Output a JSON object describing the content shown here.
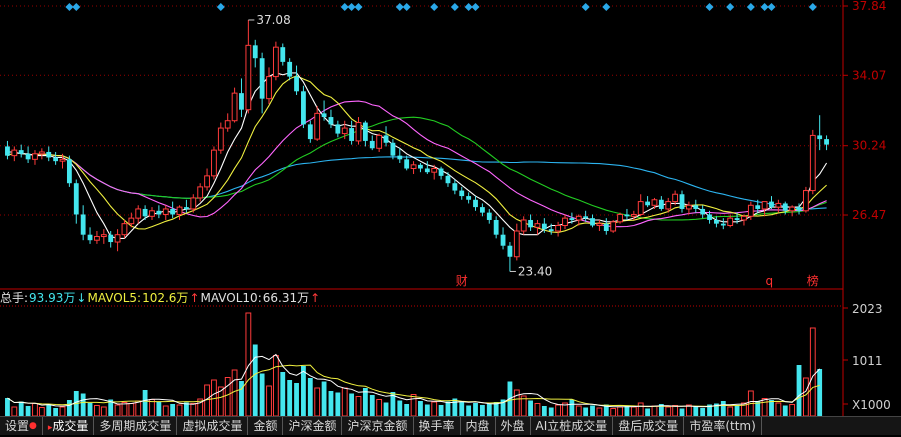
{
  "colors": {
    "up": "#ff3b3b",
    "down": "#44e6ee",
    "ma5": "#ffffff",
    "ma10": "#f0f040",
    "ma20": "#ff66ff",
    "ma30": "#22cc22",
    "ma60": "#2cb4f0",
    "axis": "#c00000",
    "diamond": "#2aa8e8"
  },
  "price_axis": {
    "labels": [
      "37.84",
      "34.07",
      "30.24",
      "26.47"
    ]
  },
  "volume_axis": {
    "labels": [
      "2023",
      "1011",
      "X1000"
    ]
  },
  "volume_header": {
    "total_label": "总手:",
    "total_value": "93.93万",
    "total_arrow": "↓",
    "ma5_label": "MAVOL5:",
    "ma5_value": "102.6万",
    "ma5_arrow": "↑",
    "ma10_label": "MAVOL10:",
    "ma10_value": "66.31万",
    "ma10_arrow": "↑"
  },
  "annotations": {
    "high": "37.08",
    "low": "23.40",
    "markers": [
      "财",
      "q",
      "榜"
    ]
  },
  "tabs": [
    {
      "label": "设置",
      "dot": "●"
    },
    {
      "label": "成交量",
      "arrow": "▸"
    },
    {
      "label": "多周期成交量"
    },
    {
      "label": "虚拟成交量"
    },
    {
      "label": "金额"
    },
    {
      "label": "沪深金额"
    },
    {
      "label": "沪深京金额"
    },
    {
      "label": "换手率"
    },
    {
      "label": "内盘"
    },
    {
      "label": "外盘"
    },
    {
      "label": "AI立桩成交量"
    },
    {
      "label": "盘后成交量"
    },
    {
      "label": "市盈率(ttm)"
    }
  ],
  "chart_data": [
    {
      "type": "candlestick",
      "ylim": [
        22.5,
        37.84
      ],
      "high_label": {
        "index": 35,
        "value": 37.08
      },
      "low_label": {
        "index": 73,
        "value": 23.4
      },
      "ohlc": [
        [
          30.2,
          30.5,
          29.5,
          29.7
        ],
        [
          29.7,
          30.2,
          29.4,
          30.0
        ],
        [
          30.0,
          30.3,
          29.6,
          29.8
        ],
        [
          29.8,
          30.2,
          29.3,
          29.5
        ],
        [
          29.5,
          30.0,
          29.2,
          29.8
        ],
        [
          29.8,
          30.1,
          29.5,
          29.9
        ],
        [
          29.9,
          30.2,
          29.4,
          29.6
        ],
        [
          29.6,
          29.9,
          29.2,
          29.4
        ],
        [
          29.4,
          29.8,
          29.0,
          29.5
        ],
        [
          29.5,
          29.7,
          28.0,
          28.2
        ],
        [
          28.2,
          28.4,
          26.0,
          26.5
        ],
        [
          26.5,
          27.0,
          25.1,
          25.4
        ],
        [
          25.4,
          25.8,
          24.9,
          25.1
        ],
        [
          25.1,
          25.6,
          24.9,
          25.3
        ],
        [
          25.3,
          25.7,
          24.9,
          25.4
        ],
        [
          25.4,
          25.6,
          24.7,
          25.0
        ],
        [
          25.0,
          25.7,
          24.5,
          25.4
        ],
        [
          25.4,
          26.2,
          25.2,
          26.0
        ],
        [
          26.0,
          26.6,
          25.8,
          26.3
        ],
        [
          26.3,
          27.0,
          26.0,
          26.8
        ],
        [
          26.8,
          27.0,
          26.2,
          26.4
        ],
        [
          26.4,
          26.9,
          26.2,
          26.7
        ],
        [
          26.7,
          27.0,
          26.3,
          26.5
        ],
        [
          26.5,
          27.0,
          26.2,
          26.8
        ],
        [
          26.8,
          27.2,
          26.3,
          26.5
        ],
        [
          26.5,
          27.0,
          26.2,
          26.9
        ],
        [
          26.9,
          27.3,
          26.6,
          26.8
        ],
        [
          26.8,
          27.6,
          26.6,
          27.4
        ],
        [
          27.4,
          28.2,
          27.2,
          28.0
        ],
        [
          28.0,
          29.0,
          27.8,
          28.6
        ],
        [
          28.6,
          30.2,
          28.4,
          30.0
        ],
        [
          30.0,
          31.5,
          29.8,
          31.2
        ],
        [
          31.2,
          32.0,
          31.0,
          31.6
        ],
        [
          31.6,
          33.4,
          31.5,
          33.1
        ],
        [
          33.1,
          33.9,
          31.8,
          32.2
        ],
        [
          32.2,
          37.08,
          32.0,
          35.7
        ],
        [
          35.7,
          36.0,
          34.5,
          35.0
        ],
        [
          35.0,
          35.3,
          32.0,
          32.8
        ],
        [
          32.8,
          34.5,
          32.5,
          34.0
        ],
        [
          34.0,
          35.9,
          33.8,
          35.6
        ],
        [
          35.6,
          35.8,
          34.6,
          34.8
        ],
        [
          34.8,
          35.0,
          33.8,
          34.0
        ],
        [
          34.0,
          34.6,
          33.0,
          33.2
        ],
        [
          33.2,
          33.5,
          31.2,
          31.4
        ],
        [
          31.4,
          31.6,
          30.4,
          30.6
        ],
        [
          30.6,
          32.4,
          30.5,
          32.0
        ],
        [
          32.0,
          32.7,
          31.6,
          31.8
        ],
        [
          31.8,
          32.2,
          31.2,
          31.4
        ],
        [
          31.4,
          31.6,
          30.7,
          30.9
        ],
        [
          30.9,
          31.6,
          30.6,
          31.2
        ],
        [
          31.2,
          31.6,
          30.3,
          30.5
        ],
        [
          30.5,
          31.8,
          30.3,
          31.5
        ],
        [
          31.5,
          31.6,
          30.2,
          30.5
        ],
        [
          30.5,
          30.8,
          30.0,
          30.1
        ],
        [
          30.1,
          30.9,
          29.9,
          30.8
        ],
        [
          30.8,
          31.3,
          30.2,
          30.4
        ],
        [
          30.4,
          30.6,
          29.5,
          29.7
        ],
        [
          29.7,
          30.1,
          29.3,
          29.5
        ],
        [
          29.5,
          29.7,
          28.9,
          29.0
        ],
        [
          29.0,
          29.4,
          28.7,
          29.2
        ],
        [
          29.2,
          29.3,
          28.8,
          29.0
        ],
        [
          29.0,
          29.4,
          28.7,
          28.8
        ],
        [
          28.8,
          29.2,
          28.4,
          29.0
        ],
        [
          29.0,
          29.1,
          28.4,
          28.6
        ],
        [
          28.6,
          28.8,
          28.0,
          28.2
        ],
        [
          28.2,
          28.4,
          27.6,
          27.8
        ],
        [
          27.8,
          28.0,
          27.3,
          27.5
        ],
        [
          27.5,
          27.7,
          27.1,
          27.3
        ],
        [
          27.3,
          27.5,
          26.7,
          26.9
        ],
        [
          26.9,
          27.1,
          26.4,
          26.6
        ],
        [
          26.6,
          26.8,
          26.0,
          26.2
        ],
        [
          26.2,
          26.4,
          25.2,
          25.4
        ],
        [
          25.4,
          25.8,
          24.6,
          24.8
        ],
        [
          24.8,
          25.0,
          23.4,
          24.2
        ],
        [
          24.2,
          26.0,
          24.0,
          25.6
        ],
        [
          25.6,
          26.4,
          25.4,
          26.2
        ],
        [
          26.2,
          26.5,
          25.6,
          25.8
        ],
        [
          25.8,
          26.2,
          25.4,
          26.0
        ],
        [
          26.0,
          26.3,
          25.5,
          25.7
        ],
        [
          25.7,
          26.0,
          25.4,
          25.6
        ],
        [
          25.6,
          26.1,
          25.3,
          25.9
        ],
        [
          25.9,
          26.5,
          25.7,
          26.3
        ],
        [
          26.3,
          26.6,
          26.0,
          26.2
        ],
        [
          26.2,
          26.5,
          25.9,
          26.4
        ],
        [
          26.4,
          26.7,
          26.1,
          26.3
        ],
        [
          26.3,
          26.5,
          25.8,
          25.9
        ],
        [
          25.9,
          26.2,
          25.6,
          26.0
        ],
        [
          26.0,
          26.3,
          25.4,
          25.6
        ],
        [
          25.6,
          26.2,
          25.5,
          26.1
        ],
        [
          26.1,
          26.6,
          26.0,
          26.5
        ],
        [
          26.5,
          26.8,
          26.2,
          26.4
        ],
        [
          26.4,
          26.7,
          26.2,
          26.5
        ],
        [
          26.5,
          27.6,
          26.4,
          27.2
        ],
        [
          27.2,
          27.5,
          26.9,
          27.0
        ],
        [
          27.0,
          27.4,
          26.8,
          27.3
        ],
        [
          27.3,
          27.5,
          26.7,
          26.8
        ],
        [
          26.8,
          27.4,
          26.6,
          27.2
        ],
        [
          27.2,
          27.8,
          27.0,
          27.6
        ],
        [
          27.6,
          27.8,
          26.6,
          26.8
        ],
        [
          26.8,
          27.2,
          26.5,
          27.0
        ],
        [
          27.0,
          27.3,
          26.6,
          26.8
        ],
        [
          26.8,
          27.0,
          26.3,
          26.5
        ],
        [
          26.5,
          26.7,
          26.0,
          26.2
        ],
        [
          26.2,
          26.4,
          25.8,
          26.0
        ],
        [
          26.0,
          26.3,
          25.7,
          25.9
        ],
        [
          25.9,
          26.5,
          25.8,
          26.3
        ],
        [
          26.3,
          26.6,
          26.0,
          26.2
        ],
        [
          26.2,
          26.5,
          25.9,
          26.4
        ],
        [
          26.4,
          27.2,
          26.2,
          27.0
        ],
        [
          27.0,
          27.3,
          26.6,
          26.8
        ],
        [
          26.8,
          27.0,
          26.4,
          27.2
        ],
        [
          27.2,
          27.5,
          26.8,
          26.9
        ],
        [
          26.9,
          27.3,
          26.6,
          27.1
        ],
        [
          27.1,
          27.2,
          26.5,
          26.7
        ],
        [
          26.7,
          27.0,
          26.4,
          26.9
        ],
        [
          26.9,
          27.1,
          26.5,
          26.7
        ],
        [
          26.7,
          28.0,
          26.6,
          27.8
        ],
        [
          27.8,
          31.1,
          27.6,
          30.8
        ],
        [
          30.8,
          31.9,
          30.0,
          30.6
        ],
        [
          30.6,
          30.8,
          30.0,
          30.3
        ]
      ],
      "ma5": [
        29.9,
        29.9,
        29.8,
        29.8,
        29.7,
        29.7,
        29.7,
        29.6,
        29.6,
        29.4,
        28.9,
        28.2,
        27.4,
        26.6,
        26.0,
        25.3,
        25.2,
        25.2,
        25.6,
        26.0,
        26.3,
        26.5,
        26.6,
        26.7,
        26.6,
        26.7,
        26.8,
        26.8,
        27.1,
        27.5,
        28.2,
        29.0,
        29.9,
        30.6,
        31.2,
        32.4,
        33.2,
        33.6,
        34.0,
        34.2,
        34.1,
        34.2,
        34.2,
        33.7,
        33.0,
        32.3,
        31.8,
        31.4,
        31.3,
        31.4,
        31.3,
        31.3,
        31.1,
        30.9,
        30.8,
        30.6,
        30.3,
        30.1,
        29.8,
        29.6,
        29.4,
        29.2,
        29.1,
        28.9,
        28.7,
        28.4,
        28.1,
        27.8,
        27.5,
        27.3,
        27.0,
        26.6,
        26.2,
        25.8,
        25.5,
        25.4,
        25.4,
        25.4,
        25.7,
        25.9,
        25.9,
        26.0,
        26.1,
        26.2,
        26.3,
        26.2,
        26.2,
        26.1,
        26.1,
        26.2,
        26.2,
        26.3,
        26.5,
        26.7,
        26.9,
        27.0,
        27.1,
        27.1,
        27.1,
        27.0,
        26.9,
        26.7,
        26.4,
        26.2,
        26.1,
        26.1,
        26.1,
        26.2,
        26.4,
        26.6,
        26.7,
        26.9,
        26.9,
        26.9,
        26.9,
        26.9,
        27.4,
        28.3,
        28.7,
        29.3
      ]
    },
    {
      "type": "bar",
      "name": "成交量",
      "ylim": [
        0,
        2200
      ],
      "unit": "X1000",
      "values": [
        360,
        180,
        290,
        200,
        250,
        170,
        230,
        160,
        180,
        320,
        500,
        450,
        260,
        210,
        180,
        330,
        220,
        270,
        250,
        300,
        520,
        330,
        280,
        200,
        240,
        220,
        270,
        250,
        340,
        620,
        720,
        580,
        770,
        920,
        700,
        2060,
        1430,
        850,
        600,
        1210,
        880,
        720,
        660,
        1000,
        760,
        560,
        690,
        500,
        470,
        560,
        450,
        390,
        560,
        420,
        330,
        270,
        480,
        310,
        240,
        430,
        300,
        230,
        280,
        220,
        290,
        350,
        300,
        210,
        260,
        220,
        240,
        280,
        330,
        690,
        520,
        400,
        310,
        250,
        200,
        170,
        220,
        260,
        330,
        200,
        170,
        210,
        160,
        230,
        150,
        180,
        200,
        180,
        260,
        150,
        200,
        240,
        180,
        210,
        150,
        220,
        190,
        160,
        230,
        250,
        300,
        180,
        210,
        260,
        500,
        300,
        350,
        320,
        260,
        210,
        230,
        1020,
        760,
        1760,
        940
      ]
    }
  ]
}
